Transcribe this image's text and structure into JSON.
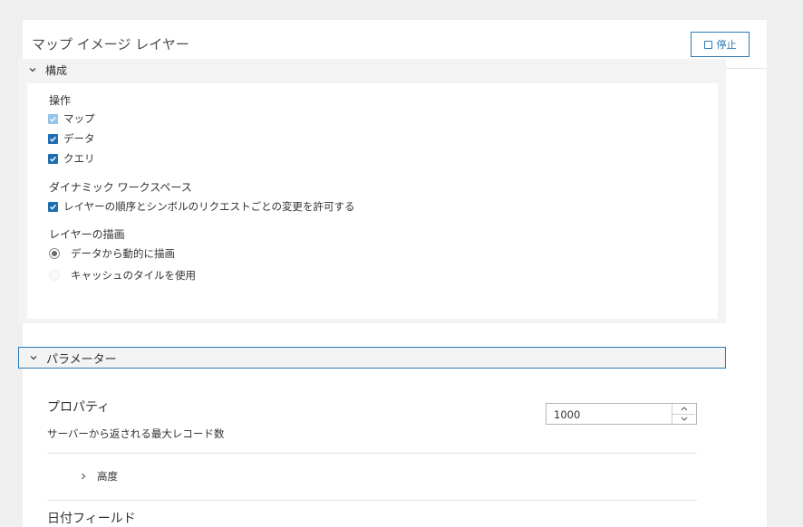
{
  "panel": {
    "title": "マップ イメージ レイヤー",
    "stop_label": "停止"
  },
  "config": {
    "title": "構成",
    "operations": {
      "label": "操作",
      "items": [
        {
          "label": "マップ",
          "checked": true,
          "disabled": true
        },
        {
          "label": "データ",
          "checked": true,
          "disabled": false
        },
        {
          "label": "クエリ",
          "checked": true,
          "disabled": false
        }
      ]
    },
    "dynamic_workspace": {
      "label": "ダイナミック ワークスペース",
      "option_label": "レイヤーの順序とシンボルのリクエストごとの変更を許可する",
      "checked": true
    },
    "drawing": {
      "label": "レイヤーの描画",
      "options": [
        {
          "label": "データから動的に描画",
          "selected": true
        },
        {
          "label": "キャッシュのタイルを使用",
          "selected": false
        }
      ]
    }
  },
  "parameters": {
    "title": "パラメーター",
    "properties": {
      "title": "プロパティ",
      "max_records_label": "サーバーから返される最大レコード数",
      "max_records_value": "1000"
    },
    "altitude_label": "高度",
    "date_fields_title": "日付フィールド"
  },
  "colors": {
    "accent": "#2b7bb8",
    "checkbox": "#1e6fb2",
    "checkbox_disabled": "#96c3e6",
    "background": "#efefef"
  },
  "icons": [
    "chevron-down-icon",
    "chevron-right-icon",
    "stop-icon",
    "checkmark-icon",
    "chevron-up-icon"
  ]
}
